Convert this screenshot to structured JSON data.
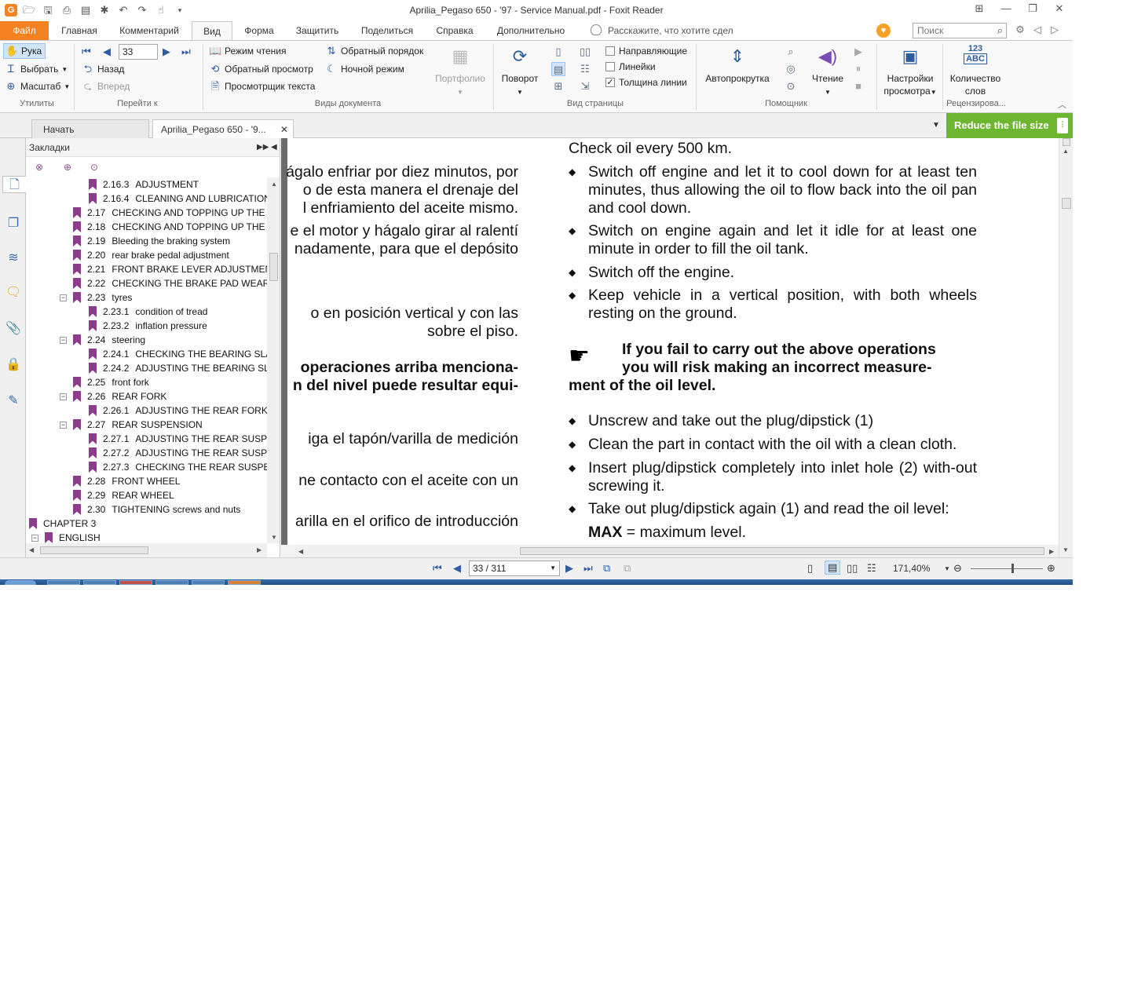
{
  "window": {
    "title": "Aprilia_Pegaso 650 - '97 - Service Manual.pdf - Foxit Reader",
    "logo": "G",
    "quick_access_icons": [
      "open-folder-icon",
      "save-icon",
      "print-icon",
      "scan-icon",
      "new-icon",
      "undo-icon",
      "redo-icon",
      "hand-tool-icon",
      "customize-icon"
    ]
  },
  "ribbon_tabs": [
    {
      "label": "Файл",
      "active": false
    },
    {
      "label": "Главная",
      "active": false
    },
    {
      "label": "Комментарий",
      "active": false
    },
    {
      "label": "Вид",
      "active": true
    },
    {
      "label": "Форма",
      "active": false
    },
    {
      "label": "Защитить",
      "active": false
    },
    {
      "label": "Поделиться",
      "active": false
    },
    {
      "label": "Справка",
      "active": false
    },
    {
      "label": "Дополнительно",
      "active": false
    }
  ],
  "tell_me": "Расскажите, что хотите сдел",
  "search": {
    "placeholder": "Поиск"
  },
  "ribbon": {
    "tools": {
      "hand": "Рука",
      "select": "Выбрать",
      "zoom": "Масштаб",
      "group": "Утилиты"
    },
    "goto": {
      "page": "33",
      "back": "Назад",
      "forward": "Вперед",
      "group": "Перейти к"
    },
    "docviews": {
      "reading_mode": "Режим чтения",
      "reverse_view": "Обратный просмотр",
      "text_viewer": "Просмотрщик текста",
      "reverse_order": "Обратный порядок",
      "night_mode": "Ночной режим",
      "portfolio": "Портфолио",
      "group": "Виды документа"
    },
    "pageview": {
      "rotate": "Поворот",
      "guides": "Направляющие",
      "rulers": "Линейки",
      "line_weight": "Толщина линии",
      "guides_checked": false,
      "rulers_checked": false,
      "line_weight_checked": true,
      "group": "Вид страницы"
    },
    "assistant": {
      "autoscroll": "Автопрокрутка",
      "read": "Чтение",
      "group": "Помощник"
    },
    "view_settings": {
      "label_line1": "Настройки",
      "label_line2": "просмотра"
    },
    "review": {
      "label_line1": "Количество",
      "label_line2": "слов",
      "icon_top": "123",
      "icon_bottom": "ABC",
      "group": "Рецензирова..."
    }
  },
  "doc_tabs": [
    {
      "label": "Начать",
      "active": false
    },
    {
      "label": "Aprilia_Pegaso 650 - '9...",
      "active": true
    }
  ],
  "reduce_banner": "Reduce the file size",
  "bookmarks": {
    "header": "Закладки",
    "items": [
      {
        "level": 3,
        "num": "2.16.3",
        "text": "ADJUSTMENT",
        "toggle": ""
      },
      {
        "level": 3,
        "num": "2.16.4",
        "text": "CLEANING AND LUBRICATION",
        "toggle": ""
      },
      {
        "level": 2,
        "num": "2.17",
        "text": "CHECKING AND TOPPING UP THE F",
        "toggle": ""
      },
      {
        "level": 2,
        "num": "2.18",
        "text": "CHECKING AND TOPPING UP THE F",
        "toggle": ""
      },
      {
        "level": 2,
        "num": "2.19",
        "text": "Bleeding the braking system",
        "toggle": ""
      },
      {
        "level": 2,
        "num": "2.20",
        "text": "rear brake pedal adjustment",
        "toggle": ""
      },
      {
        "level": 2,
        "num": "2.21",
        "text": "FRONT BRAKE LEVER ADJUSTMENT",
        "toggle": ""
      },
      {
        "level": 2,
        "num": "2.22",
        "text": "CHECKING THE BRAKE PAD WEAR",
        "toggle": ""
      },
      {
        "level": 2,
        "num": "2.23",
        "text": "tyres",
        "toggle": "−"
      },
      {
        "level": 3,
        "num": "2.23.1",
        "text": "condition of tread",
        "toggle": ""
      },
      {
        "level": 3,
        "num": "2.23.2",
        "text": "inflation pressure",
        "toggle": ""
      },
      {
        "level": 2,
        "num": "2.24",
        "text": "steering",
        "toggle": "−"
      },
      {
        "level": 3,
        "num": "2.24.1",
        "text": "CHECKING THE BEARING SLAC",
        "toggle": ""
      },
      {
        "level": 3,
        "num": "2.24.2",
        "text": "ADJUSTING THE BEARING SLA",
        "toggle": ""
      },
      {
        "level": 2,
        "num": "2.25",
        "text": "front fork",
        "toggle": ""
      },
      {
        "level": 2,
        "num": "2.26",
        "text": "REAR FORK",
        "toggle": "−"
      },
      {
        "level": 3,
        "num": "2.26.1",
        "text": "ADJUSTING THE REAR FORK",
        "toggle": ""
      },
      {
        "level": 2,
        "num": "2.27",
        "text": "REAR SUSPENSION",
        "toggle": "−"
      },
      {
        "level": 3,
        "num": "2.27.1",
        "text": "ADJUSTING THE REAR SUSPE",
        "toggle": ""
      },
      {
        "level": 3,
        "num": "2.27.2",
        "text": "ADJUSTING THE REAR SUSPE",
        "toggle": ""
      },
      {
        "level": 3,
        "num": "2.27.3",
        "text": "CHECKING THE REAR SUSPEN",
        "toggle": ""
      },
      {
        "level": 2,
        "num": "2.28",
        "text": "FRONT WHEEL",
        "toggle": ""
      },
      {
        "level": 2,
        "num": "2.29",
        "text": "REAR WHEEL",
        "toggle": ""
      },
      {
        "level": 2,
        "num": "2.30",
        "text": "TIGHTENING screws and nuts",
        "toggle": ""
      },
      {
        "level": 0,
        "num": "",
        "text": "CHAPTER 3",
        "toggle": "−"
      },
      {
        "level": 1,
        "num": "",
        "text": "ENGLISH",
        "toggle": "−"
      }
    ]
  },
  "document": {
    "spanish_lines": [
      {
        "text": "ágalo enfriar por diez minutos, por",
        "bold": false
      },
      {
        "text": "o de esta manera el drenaje del",
        "bold": false
      },
      {
        "text": "l enfriamiento del aceite mismo.",
        "bold": false
      },
      {
        "text": "e el motor y hágalo girar al ralentí",
        "bold": false
      },
      {
        "text": "nadamente, para que el depósito",
        "bold": false
      },
      {
        "text": "o en posición vertical y con las",
        "bold": false
      },
      {
        "text": "sobre el piso.",
        "bold": false
      },
      {
        "text": "operaciones arriba menciona-",
        "bold": true
      },
      {
        "text": "n del nivel puede resultar equi-",
        "bold": true
      },
      {
        "text": "iga el tapón/varilla de medición",
        "bold": false
      },
      {
        "text": "ne contacto con el aceite con un",
        "bold": false
      },
      {
        "text": "arilla en el orifico de introducción",
        "bold": false
      }
    ],
    "english_intro": "Check oil every 500 km.",
    "english_bullets_1": [
      "Switch off engine and let it to cool down for at least ten minutes, thus allowing the oil to flow back into the oil pan and cool down.",
      "Switch on engine again and let it idle for at least one minute in order to fill the oil tank.",
      "Switch off the engine.",
      "Keep vehicle in a vertical position, with both wheels resting on the ground."
    ],
    "warning_line1": "If you fail to carry out the above operations",
    "warning_line2": "you will risk making an incorrect measure-",
    "warning_line3": "ment of the oil level.",
    "english_bullets_2": [
      "Unscrew and take out the plug/dipstick (1)",
      "Clean the part in contact with the oil with a clean cloth.",
      "Insert plug/dipstick completely into inlet hole (2) with-out screwing it.",
      "Take out plug/dipstick again (1) and read the oil level:"
    ],
    "max_label": "MAX",
    "max_text": " = maximum level."
  },
  "status": {
    "page": "33 / 311",
    "zoom": "171,40%"
  }
}
